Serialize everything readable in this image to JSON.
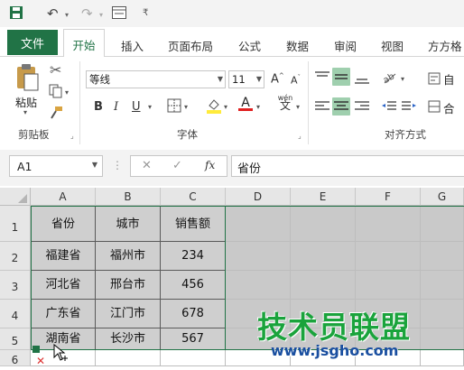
{
  "quick_access": {
    "icons": [
      "save-icon",
      "undo-icon",
      "redo-icon",
      "form-icon",
      "customize-icon"
    ]
  },
  "tabs": {
    "file": "文件",
    "active": "开始",
    "items": [
      "插入",
      "页面布局",
      "公式",
      "数据",
      "审阅",
      "视图",
      "方方格"
    ]
  },
  "ribbon": {
    "clipboard": {
      "paste_label": "粘贴",
      "group_label": "剪贴板"
    },
    "font": {
      "font_name": "等线",
      "font_size": "11",
      "bold": "B",
      "italic": "I",
      "underline": "U",
      "grow_font": "A",
      "shrink_font": "A",
      "font_color_letter": "A",
      "phonetic": "wén",
      "phonetic_char": "文",
      "group_label": "字体"
    },
    "alignment": {
      "group_label": "对齐方式",
      "wrap_label": "自",
      "merge_label": "合"
    }
  },
  "formula_bar": {
    "name_box": "A1",
    "fx_label": "fx",
    "cancel": "✕",
    "enter": "✓",
    "formula": "省份"
  },
  "sheet": {
    "columns": [
      "A",
      "B",
      "C",
      "D",
      "E",
      "F",
      "G"
    ],
    "rows": [
      "1",
      "2",
      "3",
      "4",
      "5",
      "6"
    ],
    "data": [
      [
        "省份",
        "城市",
        "销售额"
      ],
      [
        "福建省",
        "福州市",
        "234"
      ],
      [
        "河北省",
        "邢台市",
        "456"
      ],
      [
        "广东省",
        "江门市",
        "678"
      ],
      [
        "湖南省",
        "长沙市",
        "567"
      ]
    ]
  },
  "watermark": {
    "title": "技术员联盟",
    "url": "www.jsgho.com"
  },
  "colors": {
    "accent": "#217346",
    "selection": "#c9c9c9",
    "watermark_green": "#1aa33c",
    "watermark_blue": "#1a4fa0"
  }
}
